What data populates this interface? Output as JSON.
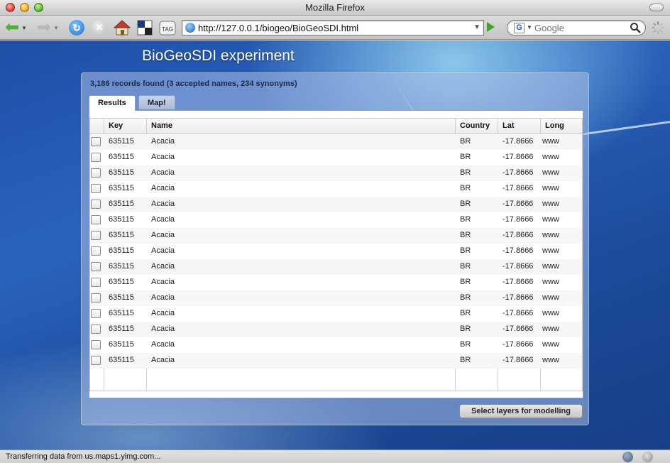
{
  "window": {
    "title": "Mozilla Firefox"
  },
  "toolbar": {
    "url": "http://127.0.0.1/biogeo/BioGeoSDI.html",
    "search_placeholder": "Google",
    "tag_label": "TAG",
    "search_engine_letter": "G"
  },
  "app": {
    "title": "BioGeoSDI experiment",
    "records_summary": "3,186 records found (3 accepted names, 234 synonyms)",
    "tabs": [
      {
        "label": "Results",
        "active": true
      },
      {
        "label": "Map!",
        "active": false
      }
    ],
    "columns": [
      "Key",
      "Name",
      "Country",
      "Lat",
      "Long"
    ],
    "rows": [
      {
        "key": "635115",
        "name": "Acacia",
        "country": "BR",
        "lat": "-17.8666",
        "long": "www"
      },
      {
        "key": "635115",
        "name": "Acacia",
        "country": "BR",
        "lat": "-17.8666",
        "long": "www"
      },
      {
        "key": "635115",
        "name": "Acacia",
        "country": "BR",
        "lat": "-17.8666",
        "long": "www"
      },
      {
        "key": "635115",
        "name": "Acacia",
        "country": "BR",
        "lat": "-17.8666",
        "long": "www"
      },
      {
        "key": "635115",
        "name": "Acacia",
        "country": "BR",
        "lat": "-17.8666",
        "long": "www"
      },
      {
        "key": "635115",
        "name": "Acacia",
        "country": "BR",
        "lat": "-17.8666",
        "long": "www"
      },
      {
        "key": "635115",
        "name": "Acacia",
        "country": "BR",
        "lat": "-17.8666",
        "long": "www"
      },
      {
        "key": "635115",
        "name": "Acacia",
        "country": "BR",
        "lat": "-17.8666",
        "long": "www"
      },
      {
        "key": "635115",
        "name": "Acacia",
        "country": "BR",
        "lat": "-17.8666",
        "long": "www"
      },
      {
        "key": "635115",
        "name": "Acacia",
        "country": "BR",
        "lat": "-17.8666",
        "long": "www"
      },
      {
        "key": "635115",
        "name": "Acacia",
        "country": "BR",
        "lat": "-17.8666",
        "long": "www"
      },
      {
        "key": "635115",
        "name": "Acacia",
        "country": "BR",
        "lat": "-17.8666",
        "long": "www"
      },
      {
        "key": "635115",
        "name": "Acacia",
        "country": "BR",
        "lat": "-17.8666",
        "long": "www"
      },
      {
        "key": "635115",
        "name": "Acacia",
        "country": "BR",
        "lat": "-17.8666",
        "long": "www"
      },
      {
        "key": "635115",
        "name": "Acacia",
        "country": "BR",
        "lat": "-17.8666",
        "long": "www"
      }
    ],
    "action_button": "Select layers for modelling"
  },
  "statusbar": {
    "text": "Transferring data from us.maps1.yimg.com..."
  },
  "icons": {
    "back": "back-arrow-icon",
    "forward": "forward-arrow-icon",
    "reload": "reload-icon",
    "stop": "stop-icon",
    "home": "home-icon",
    "bookmark": "bookmark-icon",
    "tag": "tag-icon",
    "go": "go-arrow-icon",
    "search": "magnifier-icon",
    "throbber": "spinner-icon"
  },
  "colors": {
    "accent": "#1f4fa8",
    "panel": "#aabee6",
    "go_green": "#49a030"
  }
}
